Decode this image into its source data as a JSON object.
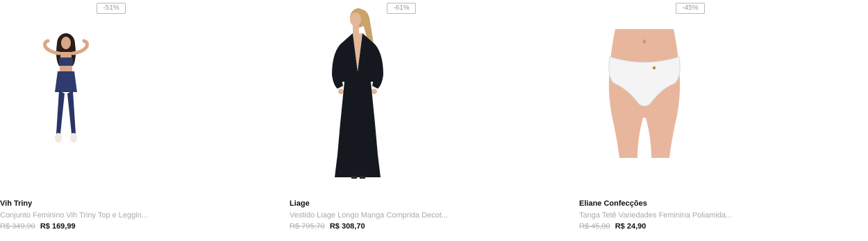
{
  "products": [
    {
      "discount": "-51%",
      "brand": "Vih Triny",
      "name": "Conjunto Feminino Vih Triny Top e Leggin...",
      "old_price": "R$ 349,90",
      "price": "R$ 169,99",
      "image": "woman-navy-top-leggings-photo"
    },
    {
      "discount": "-61%",
      "brand": "Liage",
      "name": "Vestido Liage Longo Manga Comprida Decot...",
      "old_price": "R$ 795,70",
      "price": "R$ 308,70",
      "image": "woman-black-long-dress-photo"
    },
    {
      "discount": "-45%",
      "brand": "Eliane Confecções",
      "name": "Tanga Tetê Variedades Feminina Poliamida...",
      "old_price": "R$ 45,00",
      "price": "R$ 24,90",
      "image": "white-panties-photo"
    }
  ]
}
